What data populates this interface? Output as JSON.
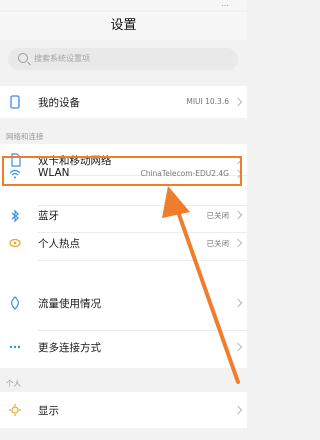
{
  "status_bar": {
    "right_text": "…"
  },
  "header": {
    "title": "设置"
  },
  "search": {
    "placeholder": "搜索系统设置项"
  },
  "device_row": {
    "label": "我的设备",
    "value": "MIUI 10.3.6"
  },
  "sections": {
    "network": "网络和连接",
    "personal": "个人"
  },
  "network_items": [
    {
      "label": "双卡和移动网络",
      "value": "",
      "icon": "sim-icon"
    },
    {
      "label": "WLAN",
      "value": "ChinaTelecom-EDU2.4G",
      "icon": "wifi-icon"
    },
    {
      "label": "蓝牙",
      "value": "已关闭",
      "icon": "bluetooth-icon"
    },
    {
      "label": "个人热点",
      "value": "已关闭",
      "icon": "hotspot-icon"
    },
    {
      "label": "流量使用情况",
      "value": "",
      "icon": "data-usage-icon"
    },
    {
      "label": "更多连接方式",
      "value": "",
      "icon": "more-icon"
    }
  ],
  "personal_items": [
    {
      "label": "显示",
      "value": "",
      "icon": "display-icon"
    }
  ],
  "colors": {
    "highlight": "#f07d2b",
    "accent": "#3a8ee6"
  }
}
